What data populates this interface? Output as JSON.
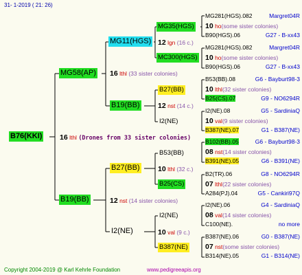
{
  "header": {
    "date": "31-   1-2019  (  21:  26)"
  },
  "footer": {
    "copyright": "Copyright 2004-2019 @ Karl Kehrle Foundation",
    "site": "www.pedigreeapis.org"
  },
  "root": {
    "label": "B76(KKI)",
    "num": "16",
    "unit": "lthl",
    "note": "(Drones from 33 sister colonies)"
  },
  "sire": {
    "label": "MG58(AP)",
    "num": "16",
    "unit": "lthl",
    "note": "(33 sister colonies)"
  },
  "dam": {
    "label": "B19(BB)",
    "num": "12",
    "unit": "nst",
    "note": "(14 sister colonies)"
  },
  "s_s": {
    "label": "MG11(HGS)",
    "num": "12",
    "unit": "lgn",
    "note": "(16 c.)"
  },
  "s_d": {
    "label": "B19(BB)",
    "num": "12",
    "unit": "nst",
    "note": "(14 c.)"
  },
  "d_s": {
    "label": "B27(BB)",
    "num": "10",
    "unit": "lthl",
    "note": "(32 c.)"
  },
  "d_d": {
    "label": "I2(NE)",
    "num": "10",
    "unit": "val",
    "note": "(9 c.)"
  },
  "ss_s": {
    "label": "MG35(HGS)"
  },
  "ss_d": {
    "label": "MC300(HGS)"
  },
  "sd_s": {
    "label": "B27(BB)"
  },
  "sd_d": {
    "label": "I2(NE)"
  },
  "ds_s": {
    "label": "B53(BB)"
  },
  "ds_d": {
    "label": "B25(CS)"
  },
  "ds_mid": {
    "num": "08",
    "unit": "nst",
    "note": "(14 sister colonies)"
  },
  "dd_s": {
    "label": "I2(NE)"
  },
  "dd_d": {
    "label": "B387(NE)"
  },
  "rows": [
    {
      "a": "MG281(HGS).082",
      "b": "Margret04R"
    },
    {
      "num": "10",
      "unit": "ho",
      "note": "(some sister colonies)"
    },
    {
      "a": "B90(HGS).06",
      "b": "G27 - B-xx43"
    },
    {
      "a": "MG281(HGS).082",
      "b": "Margret04R"
    },
    {
      "num": "10",
      "unit": "ho",
      "note": "(some sister colonies)"
    },
    {
      "a": "B90(HGS).06",
      "b": "G27 - B-xx43"
    },
    {
      "a": "B53(BB).08",
      "b": "G6 - Bayburt98-3"
    },
    {
      "num": "10",
      "unit": "lthl",
      "note": "(32 sister colonies)"
    },
    {
      "a": "B25(CS).07",
      "b": "G9 - NO6294R"
    },
    {
      "a": "I2(NE).08",
      "b": "G5 - SardiniaQ"
    },
    {
      "num": "10",
      "unit": "val",
      "note": "(9 sister colonies)"
    },
    {
      "a": "B387(NE).07",
      "b": "G1 - B387(NE)"
    },
    {
      "a": "B102(BB).05",
      "b": "G6 - Bayburt98-3"
    },
    {
      "num": "08",
      "unit": "nst",
      "note": "(14 sister colonies)"
    },
    {
      "a": "B391(NE).05",
      "b": "G6 - B391(NE)"
    },
    {
      "a": "B2(TR).06",
      "b": "G8 - NO6294R"
    },
    {
      "num": "07",
      "unit": "lthl",
      "note": "(22 sister colonies)"
    },
    {
      "a": "A284(PJ).04",
      "b": "G5 - Cankiri97Q"
    },
    {
      "a": "I2(NE).06",
      "b": "G4 - SardiniaQ"
    },
    {
      "num": "08",
      "unit": "val",
      "note": "(14 sister colonies)"
    },
    {
      "a": "C100(NE).",
      "b": "no more"
    },
    {
      "a": "B387(NE).06",
      "b": "G0 - B387(NE)"
    },
    {
      "num": "07",
      "unit": "nst",
      "note": "(some sister colonies)"
    },
    {
      "a": "B314(NE).05",
      "b": "G1 - B314(NE)"
    }
  ]
}
